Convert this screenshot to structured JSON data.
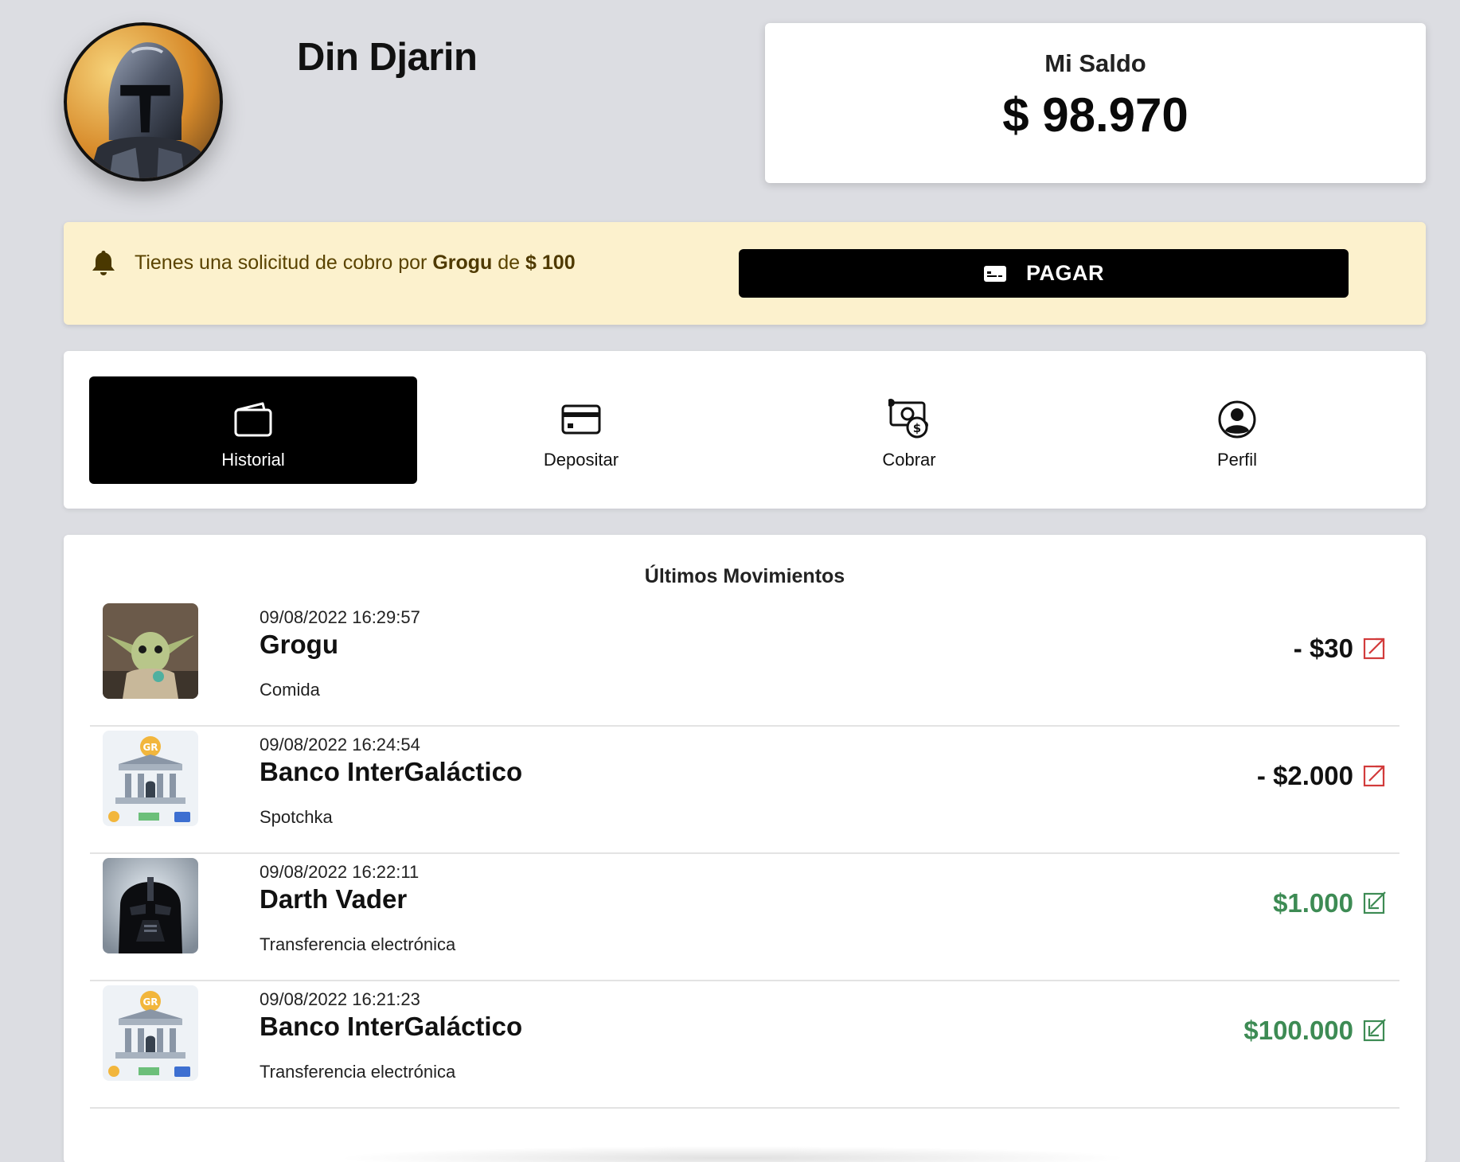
{
  "user": {
    "name": "Din Djarin",
    "avatar_icon": "mandalorian-avatar"
  },
  "balance": {
    "label": "Mi Saldo",
    "amount": "$ 98.970"
  },
  "notice": {
    "icon": "bell-icon",
    "text_prefix": "Tienes una solicitud de cobro por",
    "requester": "Grogu",
    "text_mid": "de",
    "amount": "$ 100",
    "pay_label": "PAGAR"
  },
  "tabs": [
    {
      "label": "Historial",
      "icon": "wallet-icon",
      "active": true
    },
    {
      "label": "Depositar",
      "icon": "credit-card-icon",
      "active": false
    },
    {
      "label": "Cobrar",
      "icon": "money-request-icon",
      "active": false
    },
    {
      "label": "Perfil",
      "icon": "user-circle-icon",
      "active": false
    }
  ],
  "movements": {
    "title": "Últimos Movimientos",
    "items": [
      {
        "date": "09/08/2022 16:29:57",
        "name": "Grogu",
        "concept": "Comida",
        "amount": "- $30",
        "direction": "out",
        "thumb": "grogu-avatar"
      },
      {
        "date": "09/08/2022 16:24:54",
        "name": "Banco InterGaláctico",
        "concept": "Spotchka",
        "amount": "- $2.000",
        "direction": "out",
        "thumb": "bank-icon"
      },
      {
        "date": "09/08/2022 16:22:11",
        "name": "Darth Vader",
        "concept": "Transferencia electrónica",
        "amount": "$1.000",
        "direction": "in",
        "thumb": "vader-avatar"
      },
      {
        "date": "09/08/2022 16:21:23",
        "name": "Banco InterGaláctico",
        "concept": "Transferencia electrónica",
        "amount": "$100.000",
        "direction": "in",
        "thumb": "bank-icon"
      }
    ]
  },
  "colors": {
    "notice_bg": "#fcf1cd",
    "income": "#3d8b54",
    "outgoing_icon": "#d23b3b",
    "active_tab": "#000000"
  }
}
